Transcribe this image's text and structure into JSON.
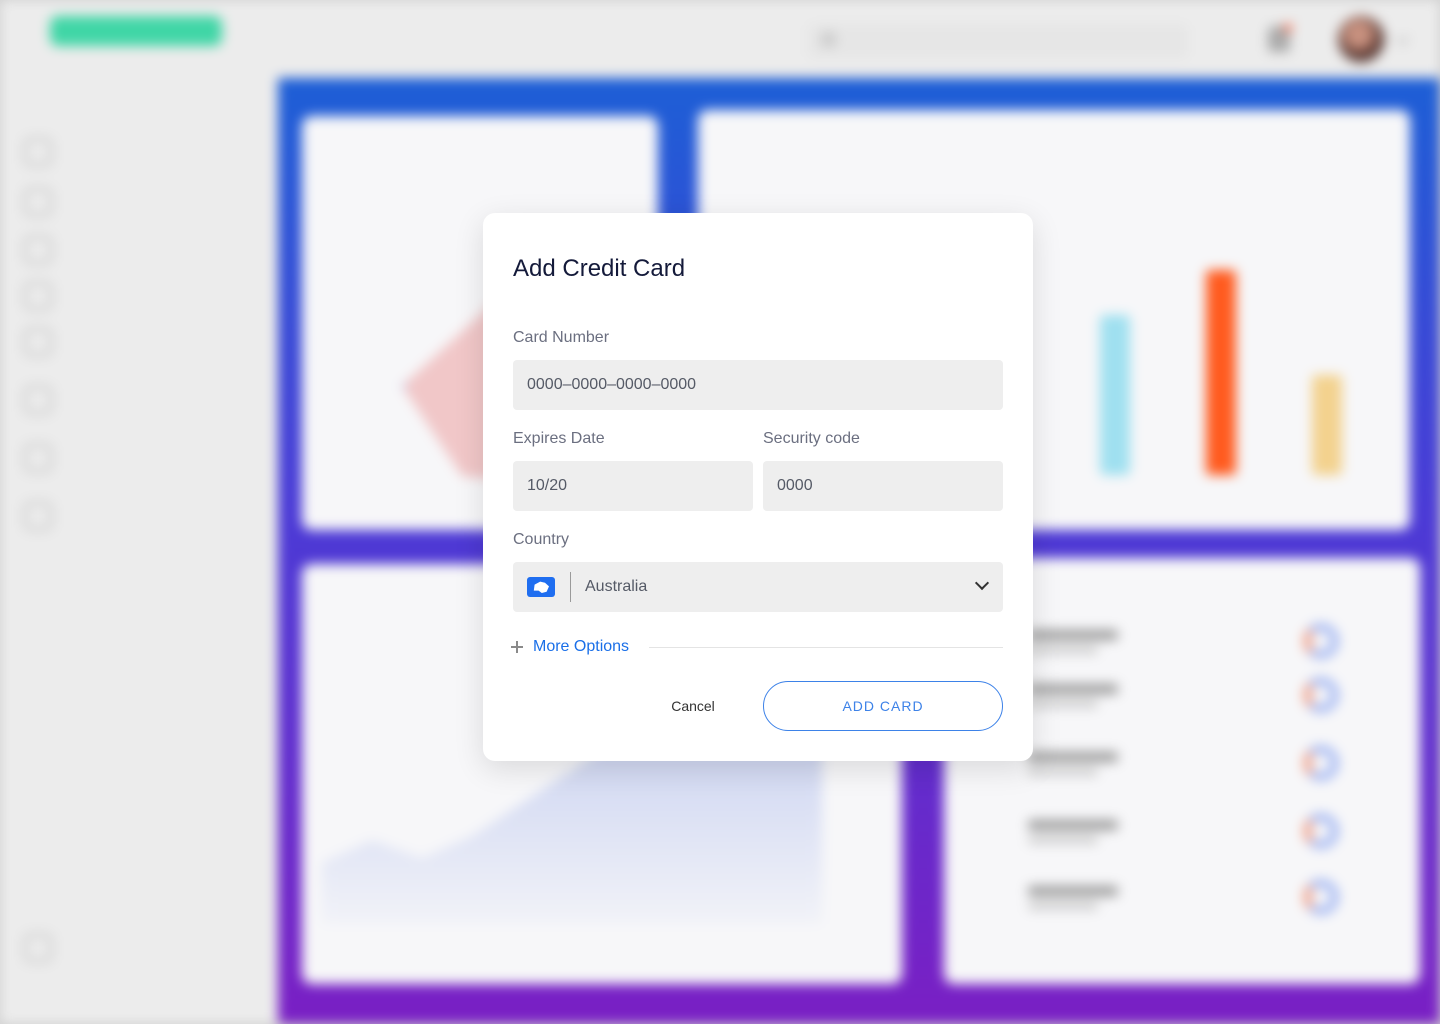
{
  "modal": {
    "title": "Add Credit Card",
    "card_number": {
      "label": "Card Number",
      "value": "0000–0000–0000–0000"
    },
    "expires": {
      "label": "Expires Date",
      "value": "10/20"
    },
    "security": {
      "label": "Security code",
      "value": "0000"
    },
    "country": {
      "label": "Country",
      "value": "Australia",
      "flag_icon": "australia-flag-icon"
    },
    "more_options_label": "More Options",
    "cancel_label": "Cancel",
    "add_card_label": "ADD CARD"
  },
  "colors": {
    "accent": "#1a6fe8",
    "background_gradient_top": "#1d5fd6",
    "background_gradient_bottom": "#7a1fc4"
  }
}
